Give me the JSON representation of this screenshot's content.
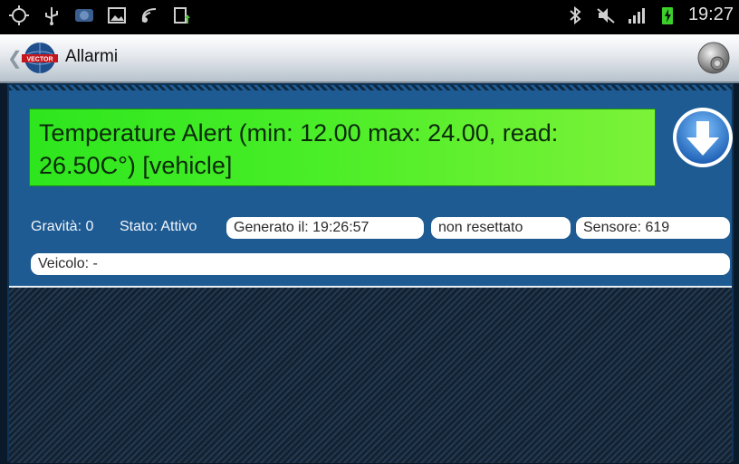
{
  "status_bar": {
    "time": "19:27",
    "left_icons": [
      "gps-icon",
      "usb-icon",
      "app-notification-icon",
      "image-icon",
      "phone-signal-icon",
      "file-upload-icon"
    ],
    "right_icons": [
      "bluetooth-icon",
      "mute-icon",
      "signal-icon",
      "battery-charging-icon"
    ]
  },
  "action_bar": {
    "title": "Allarmi",
    "logo_text": "VECTOR"
  },
  "alert": {
    "message": "Temperature Alert (min: 12.00 max: 24.00, read: 26.50C°) [vehicle]",
    "background_color": "#45ed26"
  },
  "details": {
    "gravita": "Gravità: 0",
    "stato": "Stato: Attivo",
    "generato": "Generato il: 19:26:57",
    "reset_status": "non resettato",
    "sensore": "Sensore: 619",
    "veicolo": "Veicolo:  -"
  },
  "colors": {
    "panel": "#1e5b93",
    "action_bar": "#e5e9ee",
    "status_bar": "#000000"
  }
}
